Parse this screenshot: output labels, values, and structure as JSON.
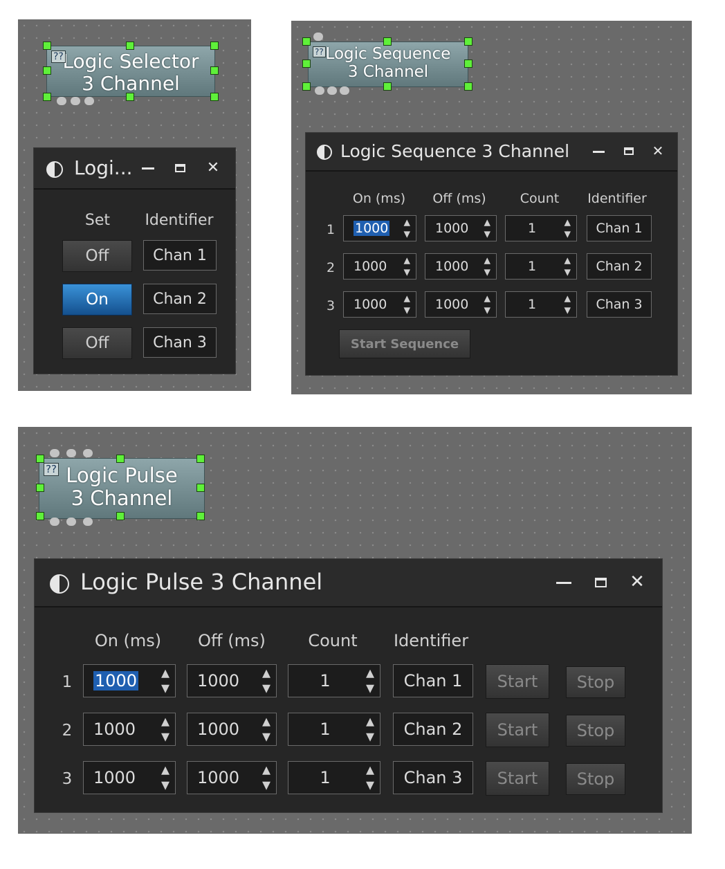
{
  "selector": {
    "block": {
      "line1": "Logic Selector",
      "line2": "3 Channel",
      "icon": "??"
    },
    "window": {
      "title": "Logi...",
      "col_set": "Set",
      "col_identifier": "Identifier",
      "rows": [
        {
          "state": "Off",
          "id": "Chan 1"
        },
        {
          "state": "On",
          "id": "Chan 2"
        },
        {
          "state": "Off",
          "id": "Chan 3"
        }
      ]
    }
  },
  "sequence": {
    "block": {
      "line1": "Logic Sequence",
      "line2": "3 Channel",
      "icon": "??"
    },
    "window": {
      "title": "Logic Sequence 3 Channel",
      "col_on": "On (ms)",
      "col_off": "Off (ms)",
      "col_count": "Count",
      "col_identifier": "Identifier",
      "rows": [
        {
          "num": "1",
          "on": "1000",
          "off": "1000",
          "count": "1",
          "id": "Chan 1"
        },
        {
          "num": "2",
          "on": "1000",
          "off": "1000",
          "count": "1",
          "id": "Chan 2"
        },
        {
          "num": "3",
          "on": "1000",
          "off": "1000",
          "count": "1",
          "id": "Chan 3"
        }
      ],
      "start_label": "Start Sequence"
    }
  },
  "pulse": {
    "block": {
      "line1": "Logic Pulse",
      "line2": "3 Channel",
      "icon": "??"
    },
    "window": {
      "title": "Logic Pulse 3 Channel",
      "col_on": "On (ms)",
      "col_off": "Off (ms)",
      "col_count": "Count",
      "col_identifier": "Identifier",
      "rows": [
        {
          "num": "1",
          "on": "1000",
          "off": "1000",
          "count": "1",
          "id": "Chan 1"
        },
        {
          "num": "2",
          "on": "1000",
          "off": "1000",
          "count": "1",
          "id": "Chan 2"
        },
        {
          "num": "3",
          "on": "1000",
          "off": "1000",
          "count": "1",
          "id": "Chan 3"
        }
      ],
      "start_label": "Start",
      "stop_label": "Stop"
    }
  },
  "window_controls": {
    "minimize": "minimize-icon",
    "maximize": "maximize-icon",
    "close": "✕"
  },
  "colors": {
    "active_blue": "#1f6fc0",
    "handle_green": "#5ff03a",
    "canvas_gray": "#6a6a6a"
  }
}
